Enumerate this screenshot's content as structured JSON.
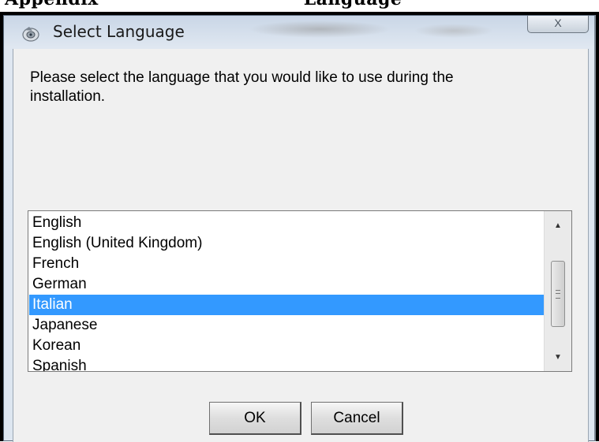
{
  "document": {
    "heading_left": "Appendix",
    "heading_right": "Language"
  },
  "window": {
    "title": "Select Language",
    "close_label": "X"
  },
  "dialog": {
    "prompt": "Please select the language that you would like to use during the installation.",
    "languages": [
      "English",
      "English (United Kingdom)",
      "French",
      "German",
      "Italian",
      "Japanese",
      "Korean",
      "Spanish"
    ],
    "selected_language": "Italian",
    "ok_label": "OK",
    "cancel_label": "Cancel"
  },
  "colors": {
    "selection": "#3399ff",
    "window_frame": "#c9d6e6",
    "client_bg": "#f0f0f0"
  },
  "icons": [
    "app-installer-icon",
    "close-icon",
    "scroll-up-arrow-icon",
    "scroll-down-arrow-icon",
    "scroll-thumb-grip-icon"
  ]
}
